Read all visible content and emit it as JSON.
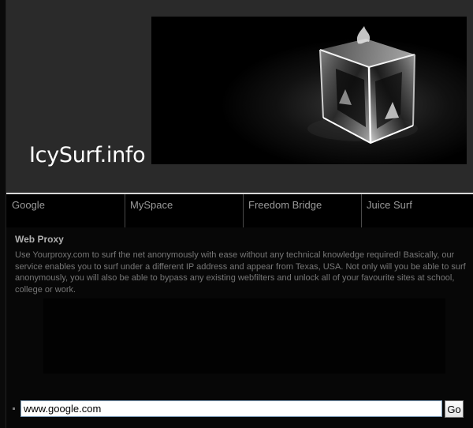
{
  "header": {
    "site_title": "IcySurf.info",
    "banner_image": "glass-cube-icon"
  },
  "nav": {
    "items": [
      {
        "label": "Google"
      },
      {
        "label": "MySpace"
      },
      {
        "label": "Freedom Bridge"
      },
      {
        "label": "Juice Surf"
      }
    ]
  },
  "content": {
    "heading": "Web Proxy",
    "body": "Use Yourproxy.com to surf the net anonymously with ease without any technical knowledge required! Basically, our service enables you to surf under a different IP address and appear from Texas, USA. Not only will you be able to surf anonymously, you will also be able to bypass any existing webfilters and unlock all of your favourite sites at school, college or work."
  },
  "form": {
    "url_value": "www.google.com",
    "go_label": "Go"
  },
  "colors": {
    "background": "#000000",
    "header_bg": "#2a2a2a",
    "nav_text": "#9a9a9a",
    "heading_text": "#b0b0b0",
    "body_text": "#777777"
  }
}
